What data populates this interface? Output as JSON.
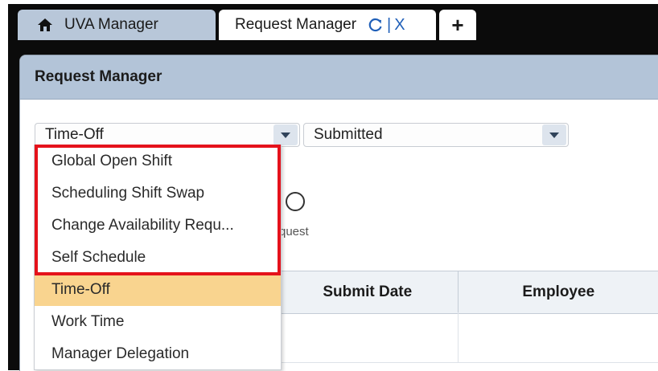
{
  "tabs": {
    "home": {
      "label": "UVA Manager",
      "icon": "home-icon"
    },
    "active": {
      "label": "Request Manager",
      "separator": "|",
      "close": "X"
    },
    "add": {
      "label": "+"
    }
  },
  "panel": {
    "title": "Request Manager"
  },
  "filters": {
    "type": {
      "value": "Time-Off"
    },
    "status": {
      "value": "Submitted"
    }
  },
  "dropdown": {
    "items": [
      {
        "label": "Global Open Shift"
      },
      {
        "label": "Scheduling Shift Swap"
      },
      {
        "label": "Change Availability Requ..."
      },
      {
        "label": "Self Schedule"
      },
      {
        "label": "Time-Off",
        "selected": true
      },
      {
        "label": "Work Time"
      },
      {
        "label": "Manager Delegation"
      }
    ]
  },
  "background": {
    "partial_label": "quest"
  },
  "grid": {
    "columns": [
      {
        "label": "Submit Date"
      },
      {
        "label": "Employee"
      }
    ]
  },
  "colors": {
    "highlight": "#e5121b",
    "selected_item": "#f9d48f",
    "header_bg": "#b3c4d8",
    "tab_bg": "#b8c7d9"
  }
}
